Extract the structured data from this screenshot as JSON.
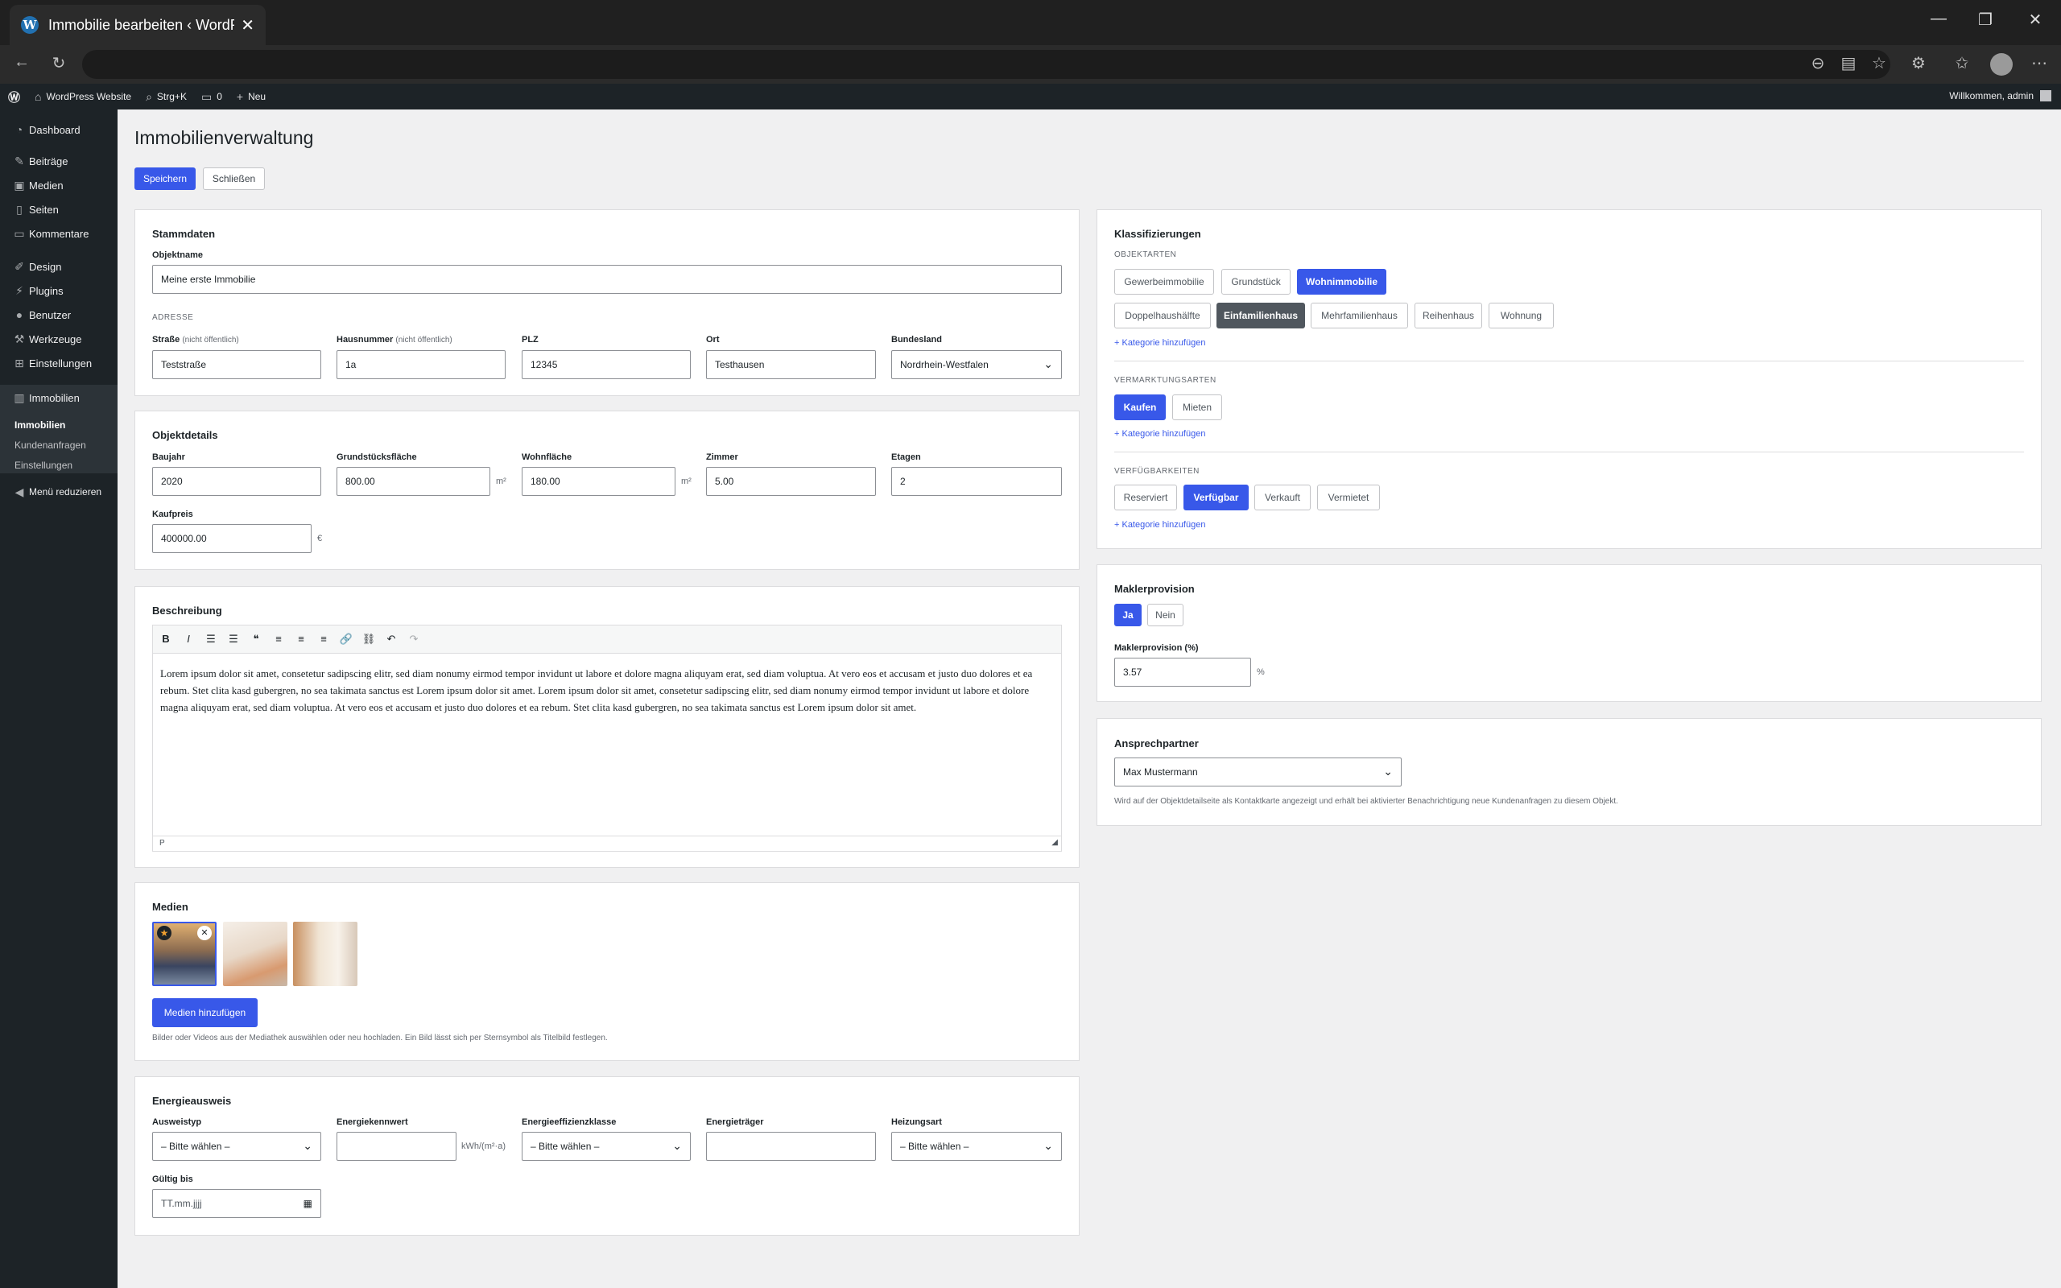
{
  "browser": {
    "tab_title": "Immobilie bearbeiten ‹ WordPress",
    "tab_close": "✕",
    "win_min": "—",
    "win_max": "❐",
    "win_close": "✕"
  },
  "adminbar": {
    "site_name": "WordPress Website",
    "search_shortcut": "Strg+K",
    "comments_count": "0",
    "new_label": "Neu",
    "welcome": "Willkommen, admin"
  },
  "sidebar": {
    "items": [
      {
        "label": "Dashboard",
        "icon": "dashboard-icon"
      },
      {
        "label": "Beiträge",
        "icon": "pin-icon"
      },
      {
        "label": "Medien",
        "icon": "media-icon"
      },
      {
        "label": "Seiten",
        "icon": "page-icon"
      },
      {
        "label": "Kommentare",
        "icon": "comment-icon"
      },
      {
        "label": "Design",
        "icon": "brush-icon"
      },
      {
        "label": "Plugins",
        "icon": "plugin-icon"
      },
      {
        "label": "Benutzer",
        "icon": "user-icon"
      },
      {
        "label": "Werkzeuge",
        "icon": "wrench-icon"
      },
      {
        "label": "Einstellungen",
        "icon": "settings-icon"
      },
      {
        "label": "Immobilien",
        "icon": "building-icon"
      }
    ],
    "submenu": [
      "Immobilien",
      "Kundenanfragen",
      "Einstellungen"
    ],
    "collapse": "Menü reduzieren"
  },
  "page": {
    "title": "Immobilienverwaltung",
    "save": "Speichern",
    "close": "Schließen"
  },
  "stammdaten": {
    "title": "Stammdaten",
    "objektname_label": "Objektname",
    "objektname_value": "Meine erste Immobilie",
    "adresse_label": "Adresse",
    "strasse_label": "Straße",
    "nicht_oeffentlich": "(nicht öffentlich)",
    "strasse_value": "Teststraße",
    "hausnummer_label": "Hausnummer",
    "hausnummer_value": "1a",
    "plz_label": "PLZ",
    "plz_value": "12345",
    "ort_label": "Ort",
    "ort_value": "Testhausen",
    "bundesland_label": "Bundesland",
    "bundesland_value": "Nordrhein-Westfalen"
  },
  "objektdetails": {
    "title": "Objektdetails",
    "baujahr_label": "Baujahr",
    "baujahr_value": "2020",
    "grund_label": "Grundstücksfläche",
    "grund_value": "800.00",
    "wohn_label": "Wohnfläche",
    "wohn_value": "180.00",
    "zimmer_label": "Zimmer",
    "zimmer_value": "5.00",
    "etagen_label": "Etagen",
    "etagen_value": "2",
    "kaufpreis_label": "Kaufpreis",
    "kaufpreis_value": "400000.00",
    "unit_m2": "m²",
    "unit_eur": "€"
  },
  "beschreibung": {
    "title": "Beschreibung",
    "toolbar": [
      "B",
      "I",
      "☰",
      "☰",
      "❝",
      "≡",
      "≡",
      "≡",
      "🔗",
      "⛓",
      "↶",
      "↷"
    ],
    "text": "Lorem ipsum dolor sit amet, consetetur sadipscing elitr, sed diam nonumy eirmod tempor invidunt ut labore et dolore magna aliquyam erat, sed diam voluptua. At vero eos et accusam et justo duo dolores et ea rebum. Stet clita kasd gubergren, no sea takimata sanctus est Lorem ipsum dolor sit amet. Lorem ipsum dolor sit amet, consetetur sadipscing elitr, sed diam nonumy eirmod tempor invidunt ut labore et dolore magna aliquyam erat, sed diam voluptua. At vero eos et accusam et justo duo dolores et ea rebum. Stet clita kasd gubergren, no sea takimata sanctus est Lorem ipsum dolor sit amet.",
    "path": "P"
  },
  "medien": {
    "title": "Medien",
    "add_button": "Medien hinzufügen",
    "help": "Bilder oder Videos aus der Mediathek auswählen oder neu hochladen. Ein Bild lässt sich per Sternsymbol als Titelbild festlegen."
  },
  "energie": {
    "title": "Energieausweis",
    "ausweistyp_label": "Ausweistyp",
    "ausweistyp_value": "– Bitte wählen –",
    "kennwert_label": "Energiekennwert",
    "kennwert_unit": "kWh/(m²·a)",
    "klasse_label": "Energieeffizienzklasse",
    "klasse_value": "– Bitte wählen –",
    "traeger_label": "Energieträger",
    "heizung_label": "Heizungsart",
    "heizung_value": "– Bitte wählen –",
    "gueltig_label": "Gültig bis",
    "gueltig_value": "TT.mm.jjjj"
  },
  "klassifizierungen": {
    "title": "Klassifizierungen",
    "objektarten_label": "Objektarten",
    "objektarten": [
      "Gewerbeimmobilie",
      "Grundstück",
      "Wohnimmobilie"
    ],
    "unterarten": [
      "Doppelhaushälfte",
      "Einfamilienhaus",
      "Mehrfamilienhaus",
      "Reihenhaus",
      "Wohnung"
    ],
    "vermarktung_label": "Vermarktungsarten",
    "vermarktung": [
      "Kaufen",
      "Mieten"
    ],
    "verfuegbar_label": "Verfügbarkeiten",
    "verfuegbar": [
      "Reserviert",
      "Verfügbar",
      "Verkauft",
      "Vermietet"
    ],
    "add_category": "+ Kategorie hinzufügen"
  },
  "makler": {
    "title": "Maklerprovision",
    "ja": "Ja",
    "nein": "Nein",
    "prov_label": "Maklerprovision (%)",
    "prov_value": "3.57",
    "unit": "%"
  },
  "ansprech": {
    "title": "Ansprechpartner",
    "value": "Max Mustermann",
    "help": "Wird auf der Objektdetailseite als Kontaktkarte angezeigt und erhält bei aktivierter Benachrichtigung neue Kundenanfragen zu diesem Objekt."
  },
  "colors": {
    "accent": "#3858e9",
    "sidebar": "#1d2327",
    "background": "#f0f0f1"
  }
}
